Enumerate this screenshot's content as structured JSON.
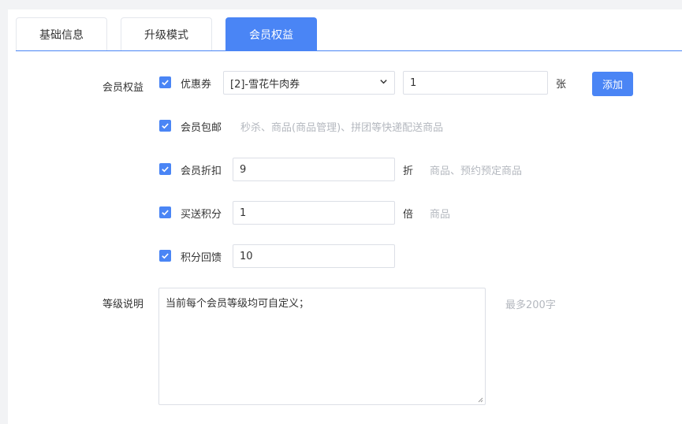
{
  "tabs": [
    {
      "label": "基础信息",
      "active": false
    },
    {
      "label": "升级模式",
      "active": false
    },
    {
      "label": "会员权益",
      "active": true
    }
  ],
  "benefits": {
    "label": "会员权益",
    "coupon": {
      "checked": true,
      "label": "优惠券",
      "select_value": "[2]-雪花牛肉券",
      "quantity": "1",
      "unit": "张",
      "add_button": "添加"
    },
    "free_shipping": {
      "checked": true,
      "label": "会员包邮",
      "hint": "秒杀、商品(商品管理)、拼团等快递配送商品"
    },
    "discount": {
      "checked": true,
      "label": "会员折扣",
      "value": "9",
      "unit": "折",
      "hint": "商品、预约预定商品"
    },
    "bonus_points": {
      "checked": true,
      "label": "买送积分",
      "value": "1",
      "unit": "倍",
      "hint": "商品"
    },
    "points_reward": {
      "checked": true,
      "label": "积分回馈",
      "value": "10"
    }
  },
  "level_description": {
    "label": "等级说明",
    "value": "当前每个会员等级均可自定义；",
    "hint": "最多200字"
  },
  "colors": {
    "accent": "#4a85f5",
    "hint_text": "#b4b8bf",
    "border": "#dcdfe6"
  }
}
